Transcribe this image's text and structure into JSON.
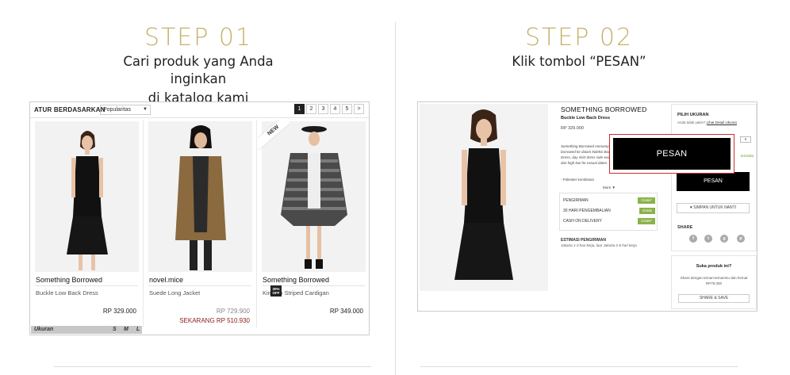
{
  "step1": {
    "title": "STEP 01",
    "line1": "Cari produk yang Anda inginkan",
    "line2": "di katalog kami"
  },
  "step2": {
    "title": "STEP 02",
    "line1": "Klik tombol “PESAN”"
  },
  "catalog": {
    "sort_label": "ATUR BERDASARKAN",
    "sort_value": "Popularitas",
    "pages": [
      "1",
      "2",
      "3",
      "4",
      "5",
      ">"
    ],
    "active_page": "1",
    "new_badge": "NEW",
    "sale_badge": "30% OFF",
    "products": [
      {
        "brand": "Something Borrowed",
        "name": "Buckle Low Back Dress",
        "price": "RP 329.000"
      },
      {
        "brand": "novel.mice",
        "name": "Suede Long Jacket",
        "price": "RP 729.900",
        "sale_price": "SEKARANG RP 510.930"
      },
      {
        "brand": "Something Borrowed",
        "name": "Kimono Striped Cardigan",
        "price": "RP 349.000"
      }
    ],
    "size_bar": {
      "label": "Ukuran",
      "sizes": [
        "S",
        "M",
        "L"
      ]
    }
  },
  "product_page": {
    "brand": "SOMETHING BORROWED",
    "name": "Buckle Low Back Dress",
    "price": "RP 329.000",
    "desc": "Something Borrowed menampilkan borrowed ke dalam koleksi Back Dress, day shirt dress side seams dan high low he casual dates.",
    "extra": "- Poliester kombinasi",
    "more": "More ▼",
    "shipping": [
      {
        "label": "PENGIRIMAN",
        "tag": "Gratis*"
      },
      {
        "label": "30 HARI PENGEMBALIAN",
        "tag": "Gratis"
      },
      {
        "label": "CASH ON DELIVERY",
        "tag": "Gratis*"
      }
    ],
    "estimate_title": "ESTIMASI PENGIRIMAN",
    "estimate_text": "Jakarta 1-3 hari kerja, luar Jakarta 2-6 hari kerja",
    "pilih_ukuran": "PILIH UKURAN",
    "anda_text": "Anda tidak yakin?",
    "size_link": "Lihat Detail Ukuran",
    "size_select": "S",
    "tersedia": "tersedia",
    "pesan_small": "PESAN",
    "pesan_big": "PESAN",
    "simpan": "♥ SIMPAN UNTUK NANTI",
    "share_label": "SHARE",
    "social": [
      "f",
      "t",
      "g",
      "p"
    ],
    "suka_title": "Suka produk ini?",
    "suka_text": "Share dengan teman-temanmu dan hemat RP75.000",
    "share_save": "SHARE & SAVE"
  },
  "colors": {
    "gold": "#c7b06b",
    "green_tag": "#8ab24a",
    "sale_red": "#8b1a1a",
    "highlight_border": "#c9302c"
  }
}
